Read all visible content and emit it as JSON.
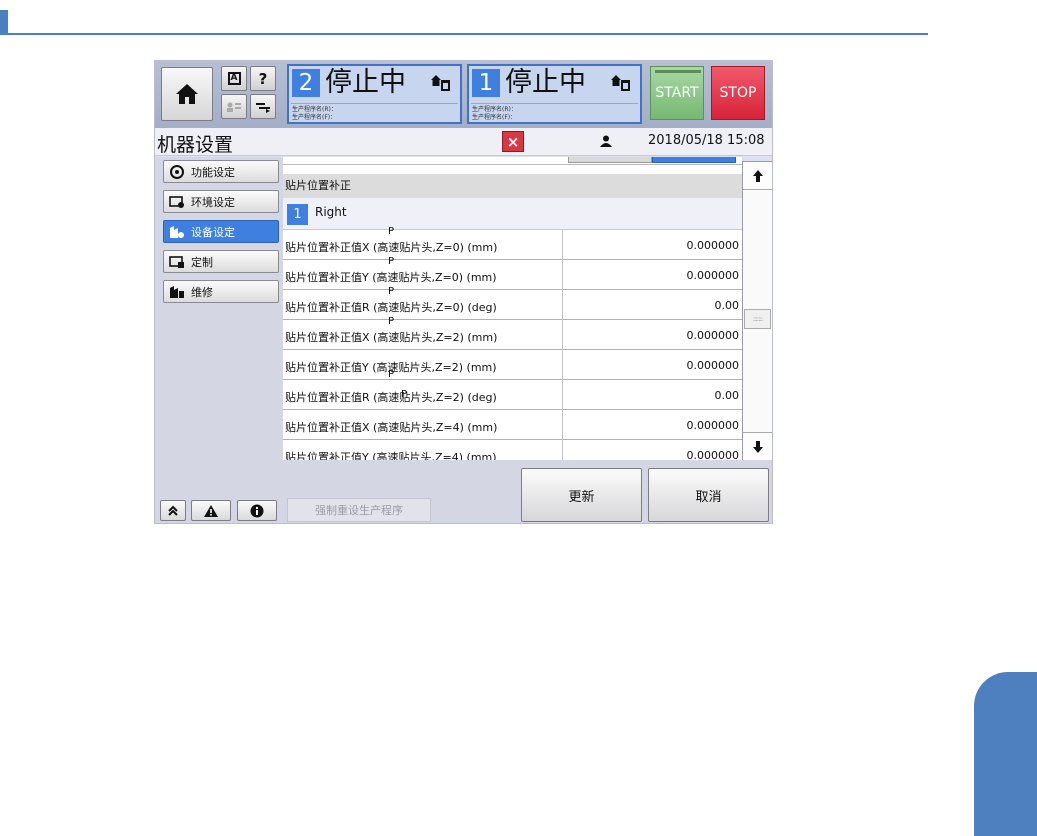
{
  "header": {
    "accent": "#4a7fc0"
  },
  "topbar": {
    "small_buttons": {
      "auto_label": "A",
      "help_label": "?"
    },
    "stations": [
      {
        "number": "2",
        "status": "停止中",
        "prog_r": "生产程序名(R)：",
        "prog_f": "生产程序名(F)："
      },
      {
        "number": "1",
        "status": "停止中",
        "prog_r": "生产程序名(R)：",
        "prog_f": "生产程序名(F)："
      }
    ],
    "start_label": "START",
    "stop_label": "STOP"
  },
  "titlebar": {
    "title": "机器设置",
    "close_label": "×",
    "datetime": "2018/05/18 15:08"
  },
  "nav": {
    "items": [
      {
        "label": "功能设定",
        "icon": "function-settings-icon"
      },
      {
        "label": "环境设定",
        "icon": "environment-settings-icon"
      },
      {
        "label": "设备设定",
        "icon": "device-settings-icon",
        "active": true
      },
      {
        "label": "定制",
        "icon": "customize-icon"
      },
      {
        "label": "维修",
        "icon": "maintenance-icon"
      }
    ]
  },
  "content": {
    "section_title": "贴片位置补正",
    "head": {
      "number": "1",
      "label": "Right"
    },
    "rows": [
      {
        "label": "贴片位置补正值X (高速贴片头,Z=0) (mm)",
        "value": "0.000000"
      },
      {
        "label": "贴片位置补正值Y (高速贴片头,Z=0) (mm)",
        "value": "0.000000"
      },
      {
        "label": "贴片位置补正值R (高速贴片头,Z=0) (deg)",
        "value": "0.00"
      },
      {
        "label": "贴片位置补正值X (高速贴片头,Z=2) (mm)",
        "value": "0.000000"
      },
      {
        "label": "贴片位置补正值Y (高速贴片头,Z=2) (mm)",
        "value": "0.000000"
      },
      {
        "label": "贴片位置补正值R (高速贴片头,Z=2) (deg)",
        "value": "0.00"
      },
      {
        "label": "贴片位置补正值X (高速贴片头,Z=4) (mm)",
        "value": "0.000000"
      },
      {
        "label": "贴片位置补正值Y (高速贴片头,Z=4) (mm)",
        "value": "0.000000"
      }
    ],
    "pointer_marker": "P"
  },
  "bottom": {
    "reset_label": "强制重设生产程序",
    "update_label": "更新",
    "cancel_label": "取消"
  }
}
